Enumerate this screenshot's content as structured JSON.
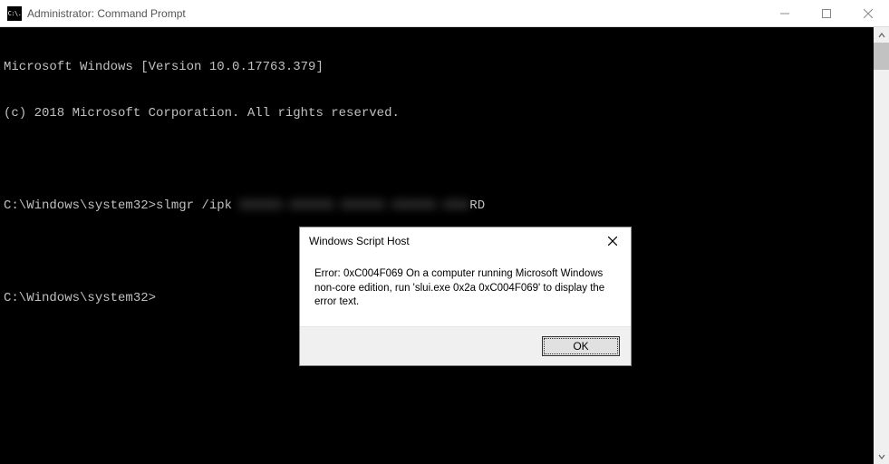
{
  "titlebar": {
    "icon_text": "C:\\.",
    "title": "Administrator: Command Prompt"
  },
  "console": {
    "line1": "Microsoft Windows [Version 10.0.17763.379]",
    "line2": "(c) 2018 Microsoft Corporation. All rights reserved.",
    "line3_prefix": "C:\\Windows\\system32>slmgr /ipk ",
    "line3_blurred": "XXXXX-XXXXX-XXXXX-XXXXX-XXX",
    "line3_suffix": "RD",
    "line4": "C:\\Windows\\system32>"
  },
  "dialog": {
    "title": "Windows Script Host",
    "message": "Error: 0xC004F069 On a computer running Microsoft Windows non-core edition, run 'slui.exe 0x2a 0xC004F069' to display the error text.",
    "ok_label": "OK"
  }
}
